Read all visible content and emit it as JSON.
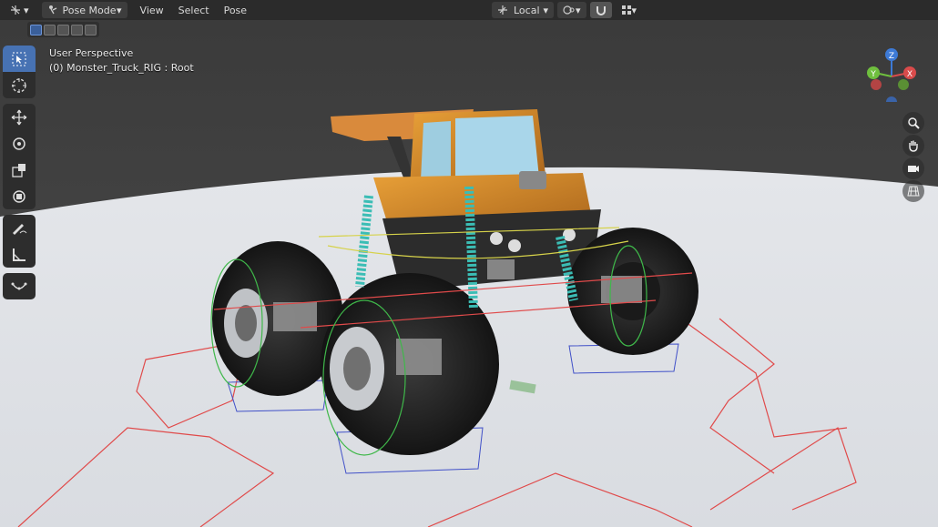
{
  "header": {
    "editor_type_icon": "gizmo-axes-icon",
    "mode": "Pose Mode",
    "menus": [
      "View",
      "Select",
      "Pose"
    ],
    "transform_orientation": "Local",
    "colors": {
      "header_bg": "#2b2b2b",
      "active_tool": "#4772b3"
    }
  },
  "viewport": {
    "view_name": "User Perspective",
    "active_object": "(0) Monster_Truck_RIG : Root"
  },
  "gizmo": {
    "z_label": "Z",
    "y_label": "Y",
    "x_label": "X"
  },
  "toolbar": {
    "tools": [
      "select-box-icon",
      "cursor-icon",
      "move-icon",
      "rotate-icon",
      "scale-icon",
      "transform-icon",
      "annotate-icon",
      "measure-icon",
      "bone-curve-icon"
    ]
  },
  "nav": [
    "zoom-icon",
    "hand-pan-icon",
    "camera-icon",
    "grid-perspective-icon"
  ]
}
